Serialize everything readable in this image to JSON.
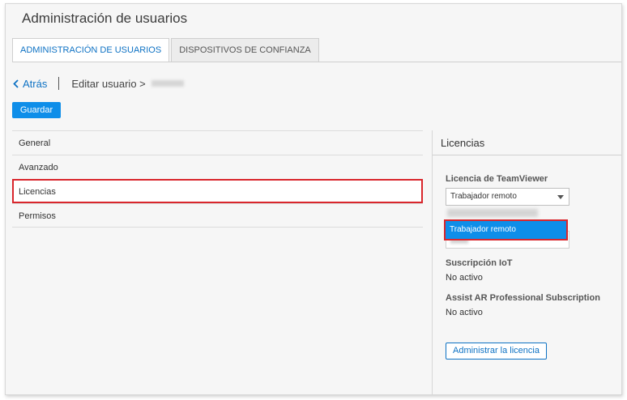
{
  "app": {
    "title": "Administración de usuarios"
  },
  "tabs": [
    {
      "label": "ADMINISTRACIÓN DE USUARIOS",
      "active": true
    },
    {
      "label": "DISPOSITIVOS DE CONFIANZA",
      "active": false
    }
  ],
  "breadcrumb": {
    "back_label": "Atrás",
    "current": "Editar usuario >"
  },
  "toolbar": {
    "save_label": "Guardar"
  },
  "left_menu": {
    "items": [
      {
        "label": "General"
      },
      {
        "label": "Avanzado"
      },
      {
        "label": "Licencias",
        "selected": true
      },
      {
        "label": "Permisos"
      }
    ]
  },
  "licenses": {
    "title": "Licencias",
    "teamviewer_label": "Licencia de TeamViewer",
    "teamviewer_value": "Trabajador remoto",
    "dropdown_highlighted_option": "Trabajador remoto",
    "iot_label": "Suscripción IoT",
    "iot_value": "No activo",
    "assist_label": "Assist AR Professional Subscription",
    "assist_value": "No activo",
    "manage_button": "Administrar la licencia"
  },
  "colors": {
    "accent": "#0e8ee9",
    "link": "#0e72c4",
    "highlight_border": "#d9262c"
  },
  "icons": {
    "back": "chevron-left-icon",
    "select_caret": "caret-down-icon"
  }
}
